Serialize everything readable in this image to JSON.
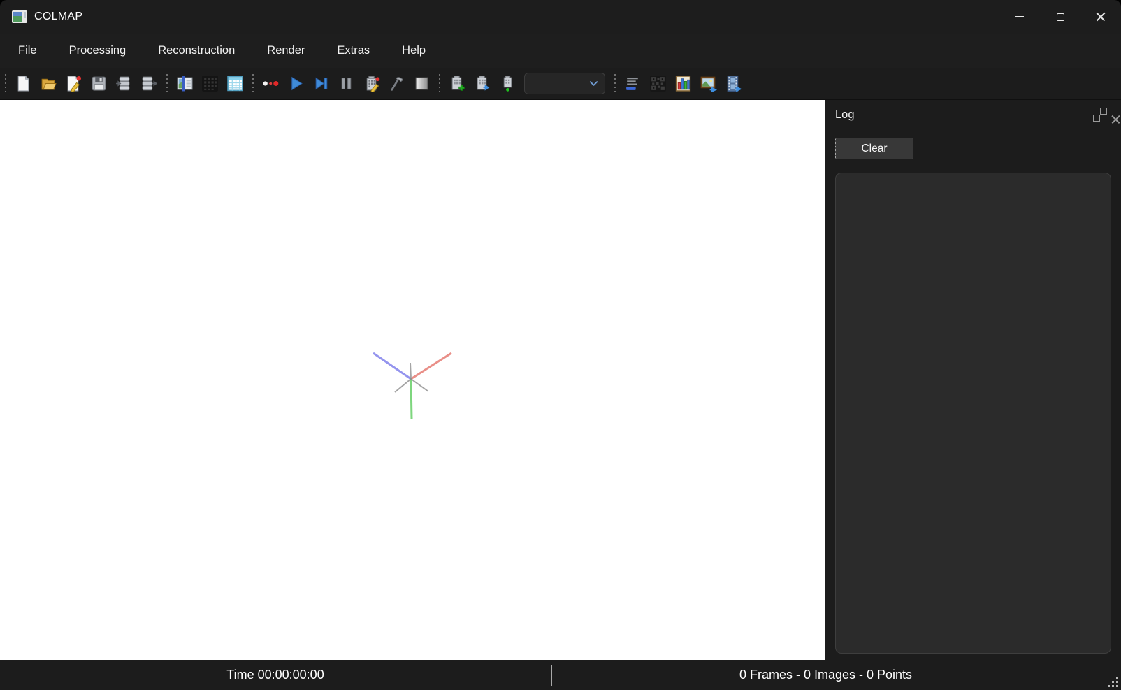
{
  "window": {
    "title": "COLMAP",
    "app_icon": "colmap-app-icon",
    "controls": {
      "minimize": "minimize",
      "maximize": "maximize",
      "close": "close"
    }
  },
  "menu_bar": {
    "items": [
      {
        "label": "File"
      },
      {
        "label": "Processing"
      },
      {
        "label": "Reconstruction"
      },
      {
        "label": "Render"
      },
      {
        "label": "Extras"
      },
      {
        "label": "Help"
      }
    ]
  },
  "toolbar": {
    "groups": [
      {
        "icons": [
          "new-project-icon",
          "open-project-icon",
          "edit-project-icon",
          "save-project-icon",
          "import-model-icon",
          "export-model-icon"
        ]
      },
      {
        "icons": [
          "feature-extraction-icon",
          "feature-matching-icon",
          "database-management-icon"
        ]
      },
      {
        "icons": [
          "reconstruction-options-icon",
          "start-reconstruction-icon",
          "step-reconstruction-icon",
          "pause-reconstruction-icon",
          "bundle-adjustment-icon",
          "dense-reconstruction-icon",
          "render-options-icon"
        ]
      },
      {
        "icons": [
          "new-model-icon",
          "import-into-model-icon",
          "model-overview-icon"
        ]
      },
      {
        "icons": [
          "log-icon",
          "match-matrix-icon",
          "statistics-icon",
          "grab-image-icon",
          "grab-movie-icon"
        ]
      }
    ],
    "model_selector": {
      "value": "",
      "icon": "chevron-down-icon"
    }
  },
  "viewport": {
    "axis_colors": {
      "x_positive": "#e4736a",
      "y_positive": "#5ecc5e",
      "z_positive": "#7070e8",
      "negative": "#8f8f8f"
    }
  },
  "log_panel": {
    "title": "Log",
    "clear_button": "Clear",
    "content": ""
  },
  "status_bar": {
    "time": "Time 00:00:00:00",
    "counts": "0 Frames - 0 Images - 0 Points"
  }
}
